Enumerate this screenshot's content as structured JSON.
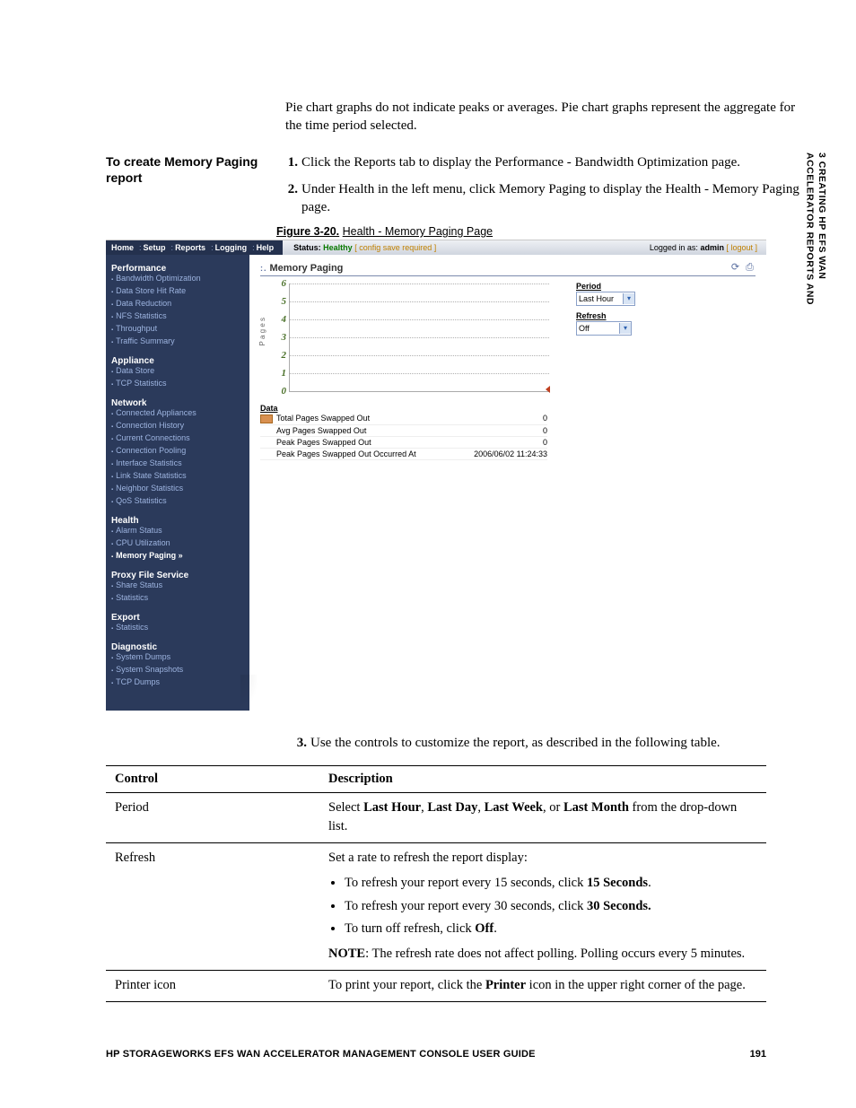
{
  "side_tab": {
    "line1": "3  CREATING HP EFS WAN",
    "line2": "ACCELERATOR REPORTS AND"
  },
  "intro": "Pie chart graphs do not indicate peaks or averages. Pie chart graphs represent the aggregate for the time period selected.",
  "section_heading": "To create Memory Paging report",
  "steps": {
    "s1": {
      "num": "1.",
      "text": "Click the Reports tab to display the Performance - Bandwidth Optimization page."
    },
    "s2": {
      "num": "2.",
      "text": "Under Health in the left menu, click Memory Paging to display the Health - Memory Paging page."
    },
    "s3": {
      "num": "3.",
      "text": "Use the controls to customize the report, as described in the following table."
    }
  },
  "figure": {
    "label": "Figure 3-20.",
    "title": "Health - Memory Paging Page"
  },
  "screenshot": {
    "nav": [
      "Home",
      "Setup",
      "Reports",
      "Logging",
      "Help"
    ],
    "status_label": "Status:",
    "status_value": "Healthy",
    "status_extra": "[ config save required ]",
    "login_prefix": "Logged in as:",
    "login_user": "admin",
    "logout": "[ logout ]",
    "page_title": "Memory Paging",
    "sidebar": [
      {
        "cat": "Performance",
        "items": [
          "Bandwidth Optimization",
          "Data Store Hit Rate",
          "Data Reduction",
          "NFS Statistics",
          "Throughput",
          "Traffic Summary"
        ]
      },
      {
        "cat": "Appliance",
        "items": [
          "Data Store",
          "TCP Statistics"
        ]
      },
      {
        "cat": "Network",
        "items": [
          "Connected Appliances",
          "Connection History",
          "Current Connections",
          "Connection Pooling",
          "Interface Statistics",
          "Link State Statistics",
          "Neighbor Statistics",
          "QoS Statistics"
        ]
      },
      {
        "cat": "Health",
        "items": [
          "Alarm Status",
          "CPU Utilization",
          "Memory Paging »"
        ],
        "active_index": 2
      },
      {
        "cat": "Proxy File Service",
        "items": [
          "Share Status",
          "Statistics"
        ]
      },
      {
        "cat": "Export",
        "items": [
          "Statistics"
        ]
      },
      {
        "cat": "Diagnostic",
        "items": [
          "System Dumps",
          "System Snapshots",
          "TCP Dumps"
        ]
      }
    ],
    "chart": {
      "y_label": "P a g e s",
      "ticks": [
        "6",
        "5",
        "4",
        "3",
        "2",
        "1",
        "0"
      ]
    },
    "controls": {
      "period_label": "Period",
      "period_value": "Last Hour",
      "refresh_label": "Refresh",
      "refresh_value": "Off"
    },
    "data_table": {
      "header": "Data",
      "rows": [
        {
          "swatch": true,
          "label": "Total Pages Swapped Out",
          "value": "0"
        },
        {
          "swatch": false,
          "label": "Avg Pages Swapped Out",
          "value": "0"
        },
        {
          "swatch": false,
          "label": "Peak Pages Swapped Out",
          "value": "0"
        },
        {
          "swatch": false,
          "label": "Peak Pages Swapped Out Occurred At",
          "value": "2006/06/02 11:24:33"
        }
      ]
    }
  },
  "controls_table": {
    "h1": "Control",
    "h2": "Description",
    "r1": {
      "ctrl": "Period",
      "desc_pre": "Select ",
      "b1": "Last Hour",
      "sep1": ", ",
      "b2": "Last Day",
      "sep2": ", ",
      "b3": "Last Week",
      "sep3": ", or ",
      "b4": "Last Month",
      "desc_post": " from the drop-down list."
    },
    "r2": {
      "ctrl": "Refresh",
      "intro": "Set a rate to refresh the report display:",
      "li1_pre": "To refresh your report every 15 seconds, click ",
      "li1_b": "15 Seconds",
      "li2_pre": "To refresh your report every 30 seconds, click ",
      "li2_b": "30 Seconds.",
      "li3_pre": "To turn off refresh, click ",
      "li3_b": "Off",
      "note_b": "NOTE",
      "note_t": ": The refresh rate does not affect polling. Polling occurs every 5 minutes."
    },
    "r3": {
      "ctrl": "Printer icon",
      "pre": "To print your report, click the ",
      "b": "Printer",
      "post": " icon in the upper right corner of the page."
    }
  },
  "footer": {
    "title": "HP STORAGEWORKS EFS WAN ACCELERATOR MANAGEMENT CONSOLE USER GUIDE",
    "page": "191"
  },
  "chart_data": {
    "type": "line",
    "title": "Memory Paging",
    "ylabel": "Pages",
    "ylim": [
      0,
      6
    ],
    "series": [
      {
        "name": "Total Pages Swapped Out",
        "values": []
      }
    ],
    "summary": {
      "Total Pages Swapped Out": 0,
      "Avg Pages Swapped Out": 0,
      "Peak Pages Swapped Out": 0,
      "Peak Pages Swapped Out Occurred At": "2006/06/02 11:24:33"
    }
  }
}
